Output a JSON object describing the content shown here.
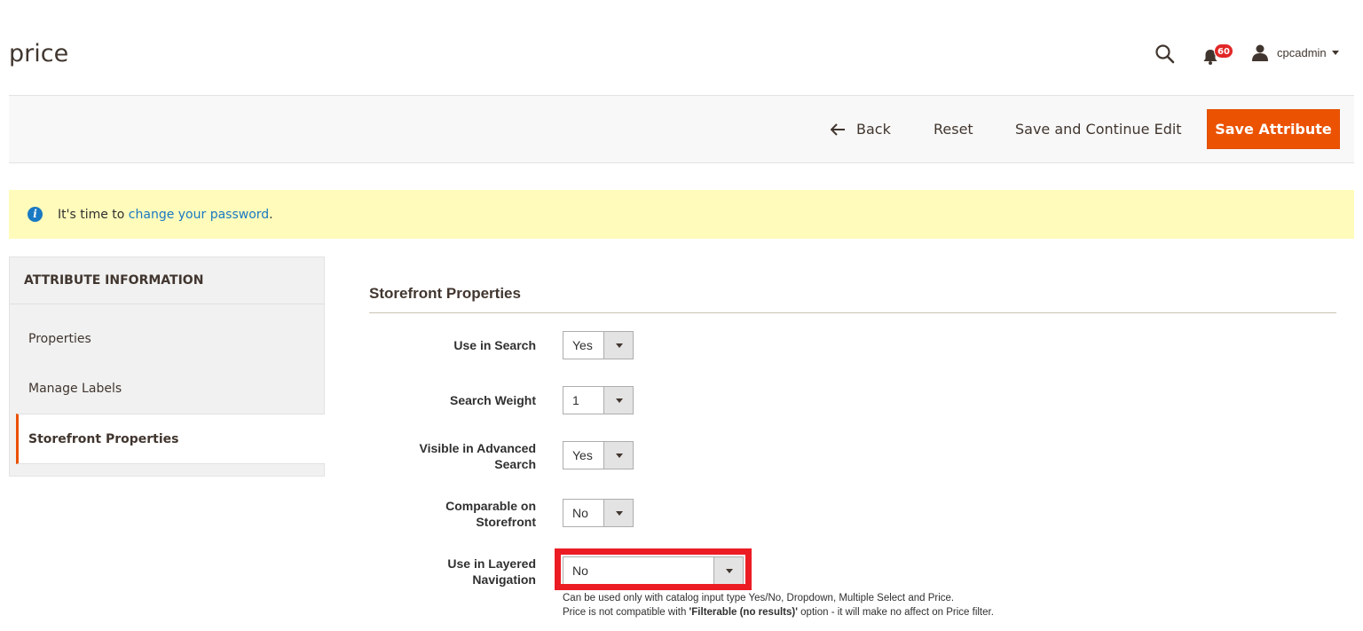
{
  "header": {
    "title": "price",
    "notifications_count": "60",
    "user_name": "cpcadmin"
  },
  "actions": {
    "back": "Back",
    "reset": "Reset",
    "save_continue": "Save and Continue Edit",
    "save_attribute": "Save Attribute"
  },
  "notice": {
    "prefix": "It's time to ",
    "link": "change your password",
    "suffix": "."
  },
  "sidebar": {
    "title": "ATTRIBUTE INFORMATION",
    "items": [
      {
        "label": "Properties"
      },
      {
        "label": "Manage Labels"
      },
      {
        "label": "Storefront Properties"
      }
    ]
  },
  "form": {
    "section_title": "Storefront Properties",
    "fields": [
      {
        "label": "Use in Search",
        "value": "Yes"
      },
      {
        "label": "Search Weight",
        "value": "1"
      },
      {
        "label": "Visible in Advanced Search",
        "value": "Yes"
      },
      {
        "label": "Comparable on Storefront",
        "value": "No"
      },
      {
        "label": "Use in Layered Navigation",
        "value": "No"
      }
    ],
    "note_line1": "Can be used only with catalog input type Yes/No, Dropdown, Multiple Select and Price.",
    "note_line2_prefix": "Price is not compatible with ",
    "note_line2_bold": "'Filterable (no results)'",
    "note_line2_suffix": " option - it will make no affect on Price filter."
  },
  "colors": {
    "accent": "#eb5202",
    "highlight": "#ec1c24",
    "notice_bg": "#fffbbb",
    "link": "#1979c3"
  }
}
